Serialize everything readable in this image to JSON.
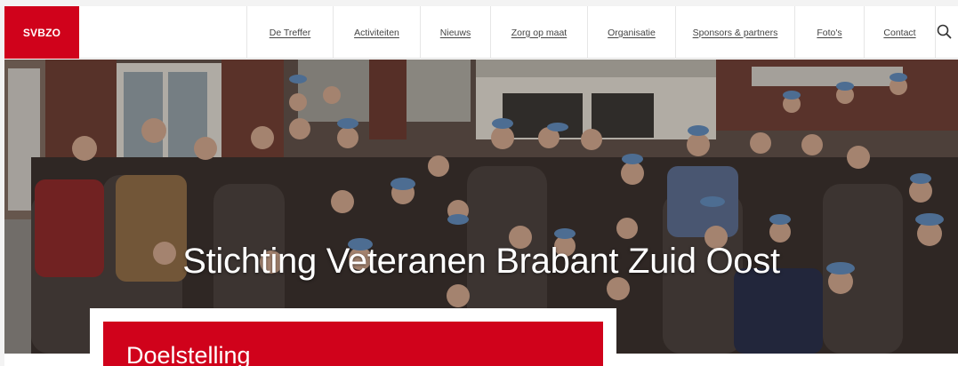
{
  "site": {
    "logo_text": "SVBZO",
    "brand_color": "#d0021b"
  },
  "nav": {
    "items": [
      {
        "label": "De Treffer"
      },
      {
        "label": "Activiteiten"
      },
      {
        "label": "Nieuws"
      },
      {
        "label": "Zorg op maat"
      },
      {
        "label": "Organisatie"
      },
      {
        "label": "Sponsors & partners"
      },
      {
        "label": "Foto's"
      },
      {
        "label": "Contact"
      }
    ],
    "search_icon": "search-icon"
  },
  "hero": {
    "title": "Stichting Veteranen Brabant Zuid Oost"
  },
  "section": {
    "title": "Doelstelling"
  }
}
